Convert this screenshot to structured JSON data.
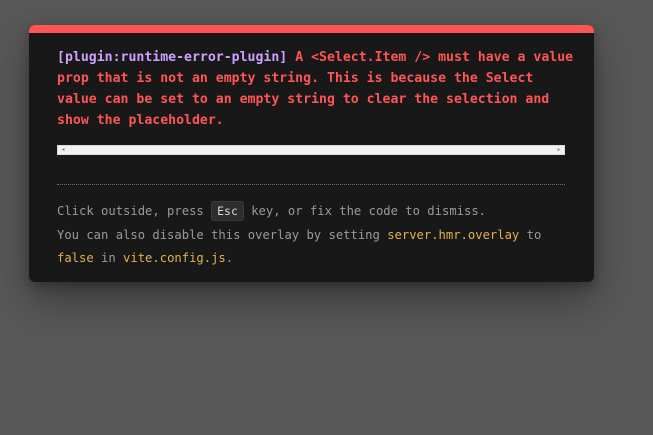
{
  "error_overlay": {
    "accent_color": "#ff5555",
    "plugin_color": "#cfa1ff",
    "code_color": "#e5b04a",
    "plugin_label": "[plugin:runtime-error-plugin]",
    "message_text": " A <Select.Item /> must have a value prop that is not an empty string. This is because the Select value can be set to an empty string to clear the selection and show the placeholder.",
    "scroll_left_glyph": "◂",
    "scroll_right_glyph": "▸",
    "tip": {
      "line1_prefix": "Click outside, press ",
      "key": "Esc",
      "line1_suffix": " key, or fix the code to dismiss.",
      "line2_prefix": "You can also disable this overlay by setting ",
      "setting": "server.hmr.overlay",
      "line2_to": " to",
      "value": "false",
      "line2_in": " in ",
      "config_file": "vite.config.js",
      "period": "."
    }
  }
}
